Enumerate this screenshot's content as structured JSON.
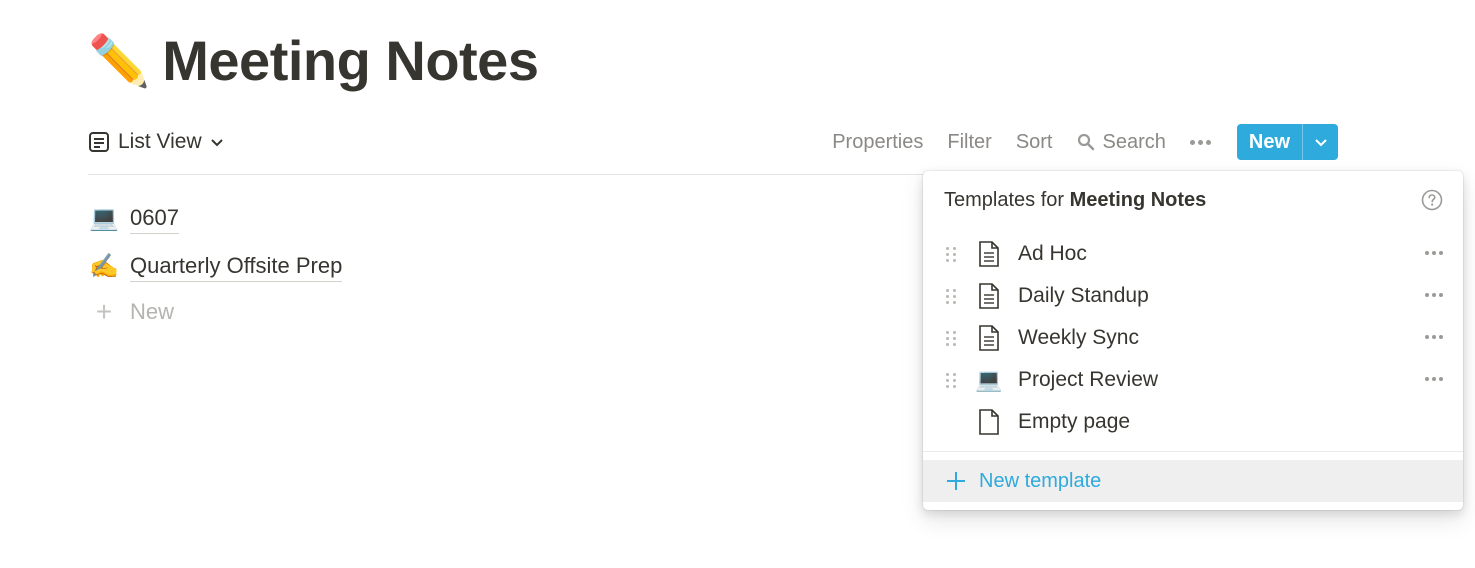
{
  "page": {
    "emoji": "✏️",
    "title": "Meeting Notes"
  },
  "toolbar": {
    "view_label": "List View",
    "properties": "Properties",
    "filter": "Filter",
    "sort": "Sort",
    "search": "Search",
    "new_label": "New"
  },
  "list": {
    "items": [
      {
        "emoji": "💻",
        "name": "0607"
      },
      {
        "emoji": "✍️",
        "name": "Quarterly Offsite Prep"
      }
    ],
    "new_label": "New"
  },
  "dropdown": {
    "header_prefix": "Templates for",
    "header_db": "Meeting Notes",
    "templates": [
      {
        "icon": "document-icon",
        "name": "Ad Hoc"
      },
      {
        "icon": "document-icon",
        "name": "Daily Standup"
      },
      {
        "icon": "document-icon",
        "name": "Weekly Sync"
      },
      {
        "icon": "laptop-emoji",
        "emoji": "💻",
        "name": "Project Review"
      },
      {
        "icon": "empty-page-icon",
        "name": "Empty page"
      }
    ],
    "new_template_label": "New template"
  },
  "colors": {
    "accent": "#2eaadc",
    "text": "#37352f",
    "muted": "#8a8985"
  }
}
